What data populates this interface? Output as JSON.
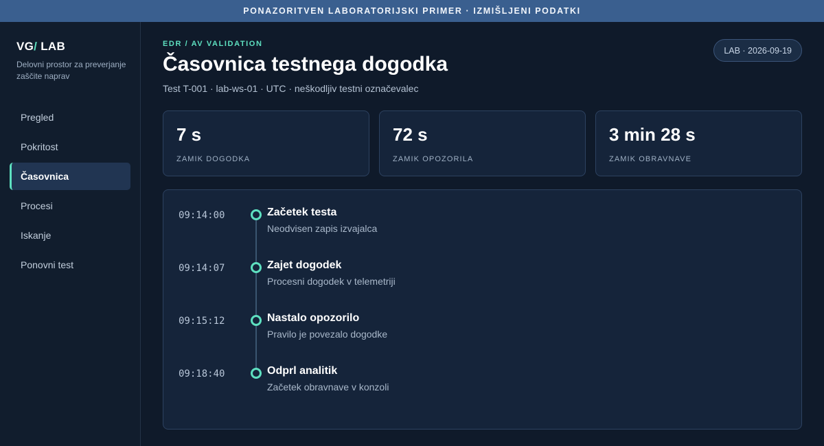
{
  "banner": "PONAZORITVEN LABORATORIJSKI PRIMER · IZMIŠLJENI PODATKI",
  "sidebar": {
    "logo_main": "VG",
    "logo_slash": "/",
    "logo_suffix": " LAB",
    "tagline": "Delovni prostor za preverjanje zaščite naprav",
    "items": [
      {
        "label": "Pregled"
      },
      {
        "label": "Pokritost"
      },
      {
        "label": "Časovnica"
      },
      {
        "label": "Procesi"
      },
      {
        "label": "Iskanje"
      },
      {
        "label": "Ponovni test"
      }
    ],
    "active_index": 2
  },
  "header": {
    "eyebrow": "EDR / AV VALIDATION",
    "title": "Časovnica testnega dogodka",
    "subtitle": "Test T-001 · lab-ws-01 · UTC · neškodljiv testni označevalec",
    "date_badge": "LAB · 2026-09-19"
  },
  "metrics": [
    {
      "value": "7 s",
      "label": "ZAMIK DOGODKA"
    },
    {
      "value": "72 s",
      "label": "ZAMIK OPOZORILA"
    },
    {
      "value": "3 min 28 s",
      "label": "ZAMIK OBRAVNAVE"
    }
  ],
  "timeline": [
    {
      "time": "09:14:00",
      "title": "Začetek testa",
      "desc": "Neodvisen zapis izvajalca"
    },
    {
      "time": "09:14:07",
      "title": "Zajet dogodek",
      "desc": "Procesni dogodek v telemetriji"
    },
    {
      "time": "09:15:12",
      "title": "Nastalo opozorilo",
      "desc": "Pravilo je povezalo dogodke"
    },
    {
      "time": "09:18:40",
      "title": "Odprl analitik",
      "desc": "Začetek obravnave v konzoli"
    }
  ],
  "colors": {
    "accent": "#5ee0c0",
    "banner": "#3a5f8f",
    "background": "#0f1a2a",
    "panel": "#15243a"
  }
}
